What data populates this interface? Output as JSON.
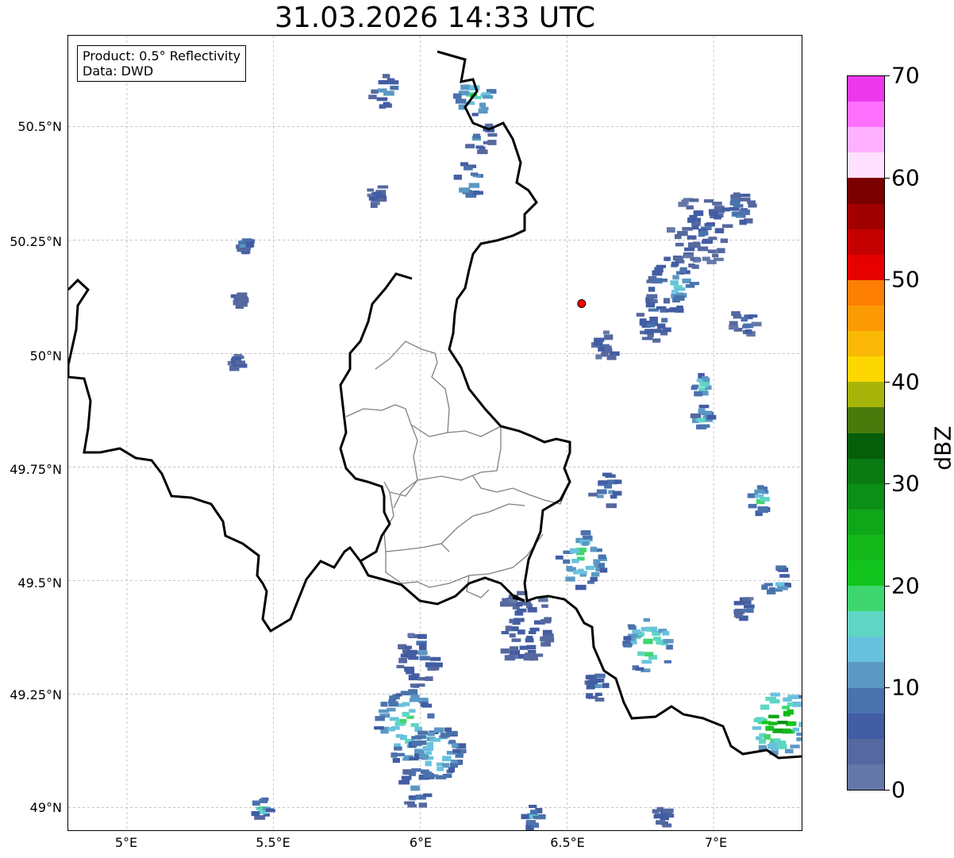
{
  "title": "31.03.2026 14:33 UTC",
  "info": {
    "product": "Product: 0.5° Reflectivity",
    "source": "Data: DWD"
  },
  "lat_ticks": [
    "50.5°N",
    "50.25°N",
    "50°N",
    "49.75°N",
    "49.5°N",
    "49.25°N",
    "49°N"
  ],
  "lon_ticks": [
    "5°E",
    "5.5°E",
    "6°E",
    "6.5°E",
    "7°E"
  ],
  "colorbar": {
    "label": "dBZ",
    "ticks": [
      "0",
      "10",
      "20",
      "30",
      "40",
      "50",
      "60",
      "70"
    ],
    "colors": [
      "#6577a8",
      "#55689f",
      "#425da3",
      "#4a72ad",
      "#5b98c4",
      "#68c2dd",
      "#5fd6c4",
      "#3fd66f",
      "#12c41e",
      "#14b81b",
      "#10a61a",
      "#0c8f16",
      "#0b7a12",
      "#075e0a",
      "#497a0c",
      "#a7b40a",
      "#fdd700",
      "#fbb806",
      "#fc9a04",
      "#fd7f04",
      "#e60000",
      "#c50000",
      "#a00000",
      "#7a0000",
      "#ffe0ff",
      "#ffb1ff",
      "#ff70ff",
      "#ec38ec"
    ]
  },
  "colors": {
    "border_national": "#000000",
    "border_regional": "#808080",
    "grid": "#b0b0b0",
    "radar_site": "#ff0000"
  },
  "map_extent": {
    "lon_min": 4.8,
    "lon_max": 7.3,
    "lat_min": 48.95,
    "lat_max": 50.7
  },
  "radar_site": {
    "lon": 6.55,
    "lat": 50.11
  },
  "echoes": [
    {
      "lon": 5.88,
      "lat": 50.58,
      "r": 0.05,
      "dbz": 10
    },
    {
      "lon": 6.18,
      "lat": 50.57,
      "r": 0.06,
      "dbz": 16
    },
    {
      "lon": 6.2,
      "lat": 50.48,
      "r": 0.05,
      "dbz": 8
    },
    {
      "lon": 6.16,
      "lat": 50.38,
      "r": 0.05,
      "dbz": 12
    },
    {
      "lon": 5.85,
      "lat": 50.35,
      "r": 0.03,
      "dbz": 6
    },
    {
      "lon": 5.4,
      "lat": 50.24,
      "r": 0.02,
      "dbz": 10
    },
    {
      "lon": 5.38,
      "lat": 50.12,
      "r": 0.02,
      "dbz": 6
    },
    {
      "lon": 5.37,
      "lat": 49.98,
      "r": 0.02,
      "dbz": 6
    },
    {
      "lon": 6.95,
      "lat": 50.27,
      "r": 0.1,
      "dbz": 6
    },
    {
      "lon": 7.08,
      "lat": 50.31,
      "r": 0.06,
      "dbz": 8
    },
    {
      "lon": 6.86,
      "lat": 50.15,
      "r": 0.08,
      "dbz": 12
    },
    {
      "lon": 6.8,
      "lat": 50.08,
      "r": 0.07,
      "dbz": 8
    },
    {
      "lon": 7.1,
      "lat": 50.07,
      "r": 0.04,
      "dbz": 8
    },
    {
      "lon": 6.63,
      "lat": 50.02,
      "r": 0.04,
      "dbz": 6
    },
    {
      "lon": 6.96,
      "lat": 49.93,
      "r": 0.03,
      "dbz": 16
    },
    {
      "lon": 6.96,
      "lat": 49.86,
      "r": 0.03,
      "dbz": 14
    },
    {
      "lon": 6.63,
      "lat": 49.7,
      "r": 0.05,
      "dbz": 10
    },
    {
      "lon": 6.55,
      "lat": 49.55,
      "r": 0.08,
      "dbz": 16
    },
    {
      "lon": 7.16,
      "lat": 49.68,
      "r": 0.04,
      "dbz": 14
    },
    {
      "lon": 7.21,
      "lat": 49.5,
      "r": 0.04,
      "dbz": 14
    },
    {
      "lon": 6.78,
      "lat": 49.36,
      "r": 0.08,
      "dbz": 18
    },
    {
      "lon": 7.22,
      "lat": 49.19,
      "r": 0.09,
      "dbz": 24
    },
    {
      "lon": 6.35,
      "lat": 49.4,
      "r": 0.1,
      "dbz": 6
    },
    {
      "lon": 6.0,
      "lat": 49.33,
      "r": 0.08,
      "dbz": 8
    },
    {
      "lon": 5.95,
      "lat": 49.18,
      "r": 0.1,
      "dbz": 16
    },
    {
      "lon": 6.05,
      "lat": 49.12,
      "r": 0.09,
      "dbz": 14
    },
    {
      "lon": 5.98,
      "lat": 49.05,
      "r": 0.06,
      "dbz": 10
    },
    {
      "lon": 6.6,
      "lat": 49.27,
      "r": 0.04,
      "dbz": 8
    },
    {
      "lon": 6.38,
      "lat": 48.98,
      "r": 0.03,
      "dbz": 12
    },
    {
      "lon": 6.82,
      "lat": 48.98,
      "r": 0.03,
      "dbz": 6
    },
    {
      "lon": 5.46,
      "lat": 49.0,
      "r": 0.03,
      "dbz": 14
    },
    {
      "lon": 7.1,
      "lat": 49.44,
      "r": 0.03,
      "dbz": 8
    }
  ]
}
